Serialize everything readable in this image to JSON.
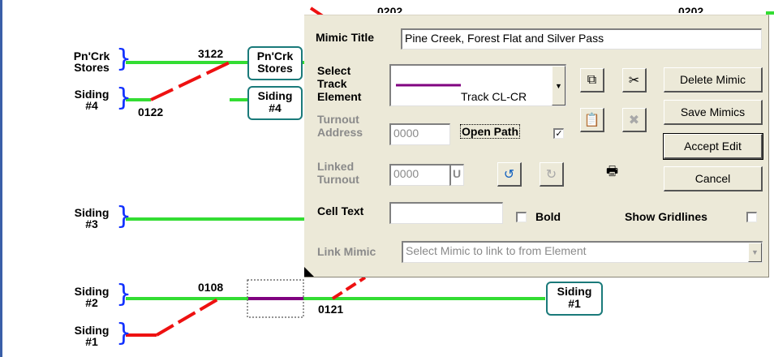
{
  "layout_panel": {
    "top_numbers": [
      "0202",
      "0202"
    ],
    "sidings": [
      {
        "name": "pncrk-stores-left",
        "line1": "Pn'Crk",
        "line2": "Stores"
      },
      {
        "name": "siding-4-left",
        "line1": "Siding",
        "line2": "#4"
      },
      {
        "name": "siding-3-left",
        "line1": "Siding",
        "line2": "#3"
      },
      {
        "name": "siding-2-left",
        "line1": "Siding",
        "line2": "#2"
      },
      {
        "name": "siding-1-left",
        "line1": "Siding",
        "line2": "#1"
      }
    ],
    "turnout_numbers": {
      "n3122": "3122",
      "n0122": "0122",
      "n0108": "0108",
      "n0121": "0121"
    },
    "tags": {
      "pncrk_stores": {
        "line1": "Pn'Crk",
        "line2": "Stores"
      },
      "siding4": {
        "line1": "Siding",
        "line2": "#4"
      },
      "siding1": {
        "line1": "Siding",
        "line2": "#1"
      }
    },
    "colors": {
      "track_green": "#33dd33",
      "track_red": "#ee1111",
      "track_purple": "#800080",
      "brace": "#1030ff",
      "tag_border": "#1a7a7a"
    }
  },
  "dialog": {
    "mimic_title_label": "Mimic Title",
    "mimic_title_value": "Pine Creek, Forest Flat and Silver Pass",
    "select_track_label": [
      "Select",
      "Track",
      "Element"
    ],
    "track_element_value": "Track CL-CR",
    "turnout_address_label": [
      "Turnout",
      "Address"
    ],
    "turnout_address_value": "0000",
    "open_path_label": "Open Path",
    "open_path_checked": "✓",
    "linked_turnout_label": [
      "Linked",
      "Turnout"
    ],
    "linked_turnout_value": "0000",
    "linked_turnout_suffix": "U",
    "cell_text_label": "Cell Text",
    "cell_text_value": "",
    "bold_label": "Bold",
    "show_gridlines_label": "Show Gridlines",
    "link_mimic_label": "Link Mimic",
    "link_mimic_placeholder": "Select Mimic to link to from Element",
    "buttons": {
      "delete_mimic": "Delete Mimic",
      "save_mimics": "Save Mimics",
      "accept_edit": "Accept Edit",
      "cancel": "Cancel"
    },
    "icons": [
      "copy-icon",
      "cut-icon",
      "paste-icon",
      "delete-cell-icon",
      "rotate-left-icon",
      "rotate-right-icon",
      "print-icon"
    ]
  }
}
